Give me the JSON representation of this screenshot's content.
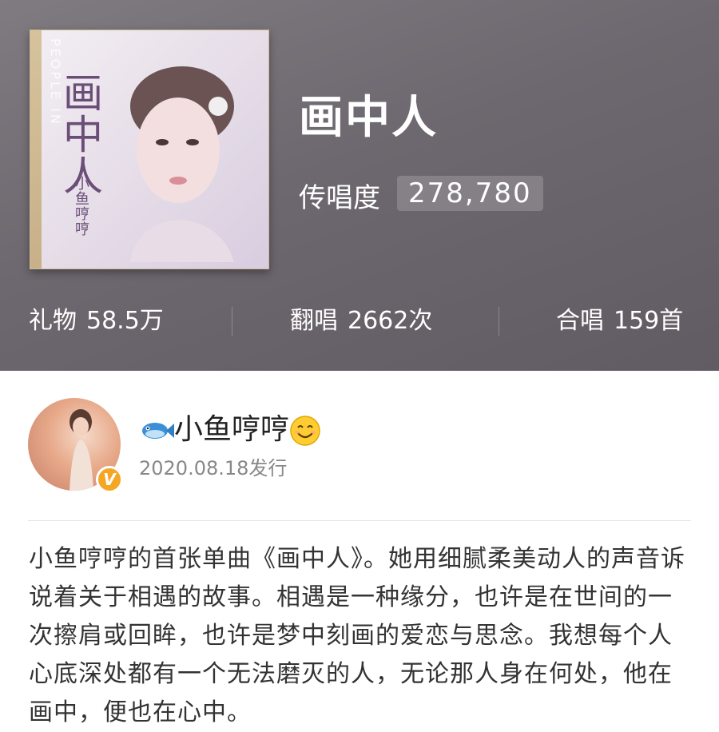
{
  "cover": {
    "title": "画中人",
    "artist": "小鱼哼哼",
    "en_text": "PEOPLE IN"
  },
  "song": {
    "title": "画中人",
    "popularity_label": "传唱度",
    "popularity_value": "278,780"
  },
  "stats": [
    {
      "label": "礼物",
      "value": "58.5万"
    },
    {
      "label": "翻唱",
      "value": "2662次"
    },
    {
      "label": "合唱",
      "value": "159首"
    }
  ],
  "artist": {
    "name": "小鱼哼哼",
    "verified_badge": "V",
    "release": "2020.08.18发行"
  },
  "description": "小鱼哼哼的首张单曲《画中人》。她用细腻柔美动人的声音诉说着关于相遇的故事。相遇是一种缘分，也许是在世间的一次擦肩或回眸，也许是梦中刻画的爱恋与思念。我想每个人心底深处都有一个无法磨灭的人，无论那人身在何处，他在画中，便也在心中。",
  "colors": {
    "header_bg": "#6d686f",
    "badge": "#f5a623",
    "cover_text": "#6b4e78"
  }
}
